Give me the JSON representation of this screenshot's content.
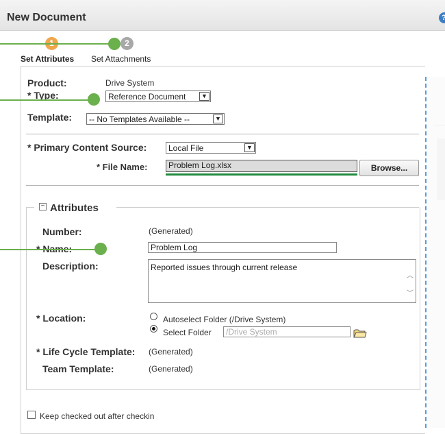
{
  "window": {
    "title": "New Document",
    "help_glyph": "?"
  },
  "steps": [
    {
      "number": "1",
      "label": "Set Attributes",
      "state": "active"
    },
    {
      "number": "2",
      "label": "Set Attachments",
      "state": "inactive"
    }
  ],
  "form": {
    "product": {
      "label": "Product:",
      "value": "Drive System"
    },
    "type": {
      "label": "* Type:",
      "value": "Reference Document"
    },
    "template": {
      "label": "Template:",
      "value": "-- No Templates Available --"
    },
    "primary_content": {
      "label": "* Primary Content Source:",
      "value": "Local File"
    },
    "file_name": {
      "label": "* File Name:",
      "value": "Problem Log.xlsx"
    },
    "browse_label": "Browse..."
  },
  "attributes": {
    "legend": "Attributes",
    "collapse_glyph": "−",
    "number": {
      "label": "Number:",
      "value": "(Generated)"
    },
    "name": {
      "label": "* Name:",
      "value": "Problem Log"
    },
    "description": {
      "label": "Description:",
      "value": "Reported issues through current release"
    },
    "location": {
      "label": "* Location:",
      "option1": "Autoselect Folder (/Drive System)",
      "option2": "Select Folder",
      "folder_value": "/Drive System",
      "selected": "option2"
    },
    "life_cycle": {
      "label": "* Life Cycle Template:",
      "value": "(Generated)"
    },
    "team_template": {
      "label": "Team Template:",
      "value": "(Generated)"
    }
  },
  "checkout": {
    "label": "Keep checked out after checkin",
    "checked": false
  },
  "colors": {
    "accent_blue": "#3c7fc4",
    "step_active": "#f0a64c",
    "callout_green": "#6ab04c"
  }
}
